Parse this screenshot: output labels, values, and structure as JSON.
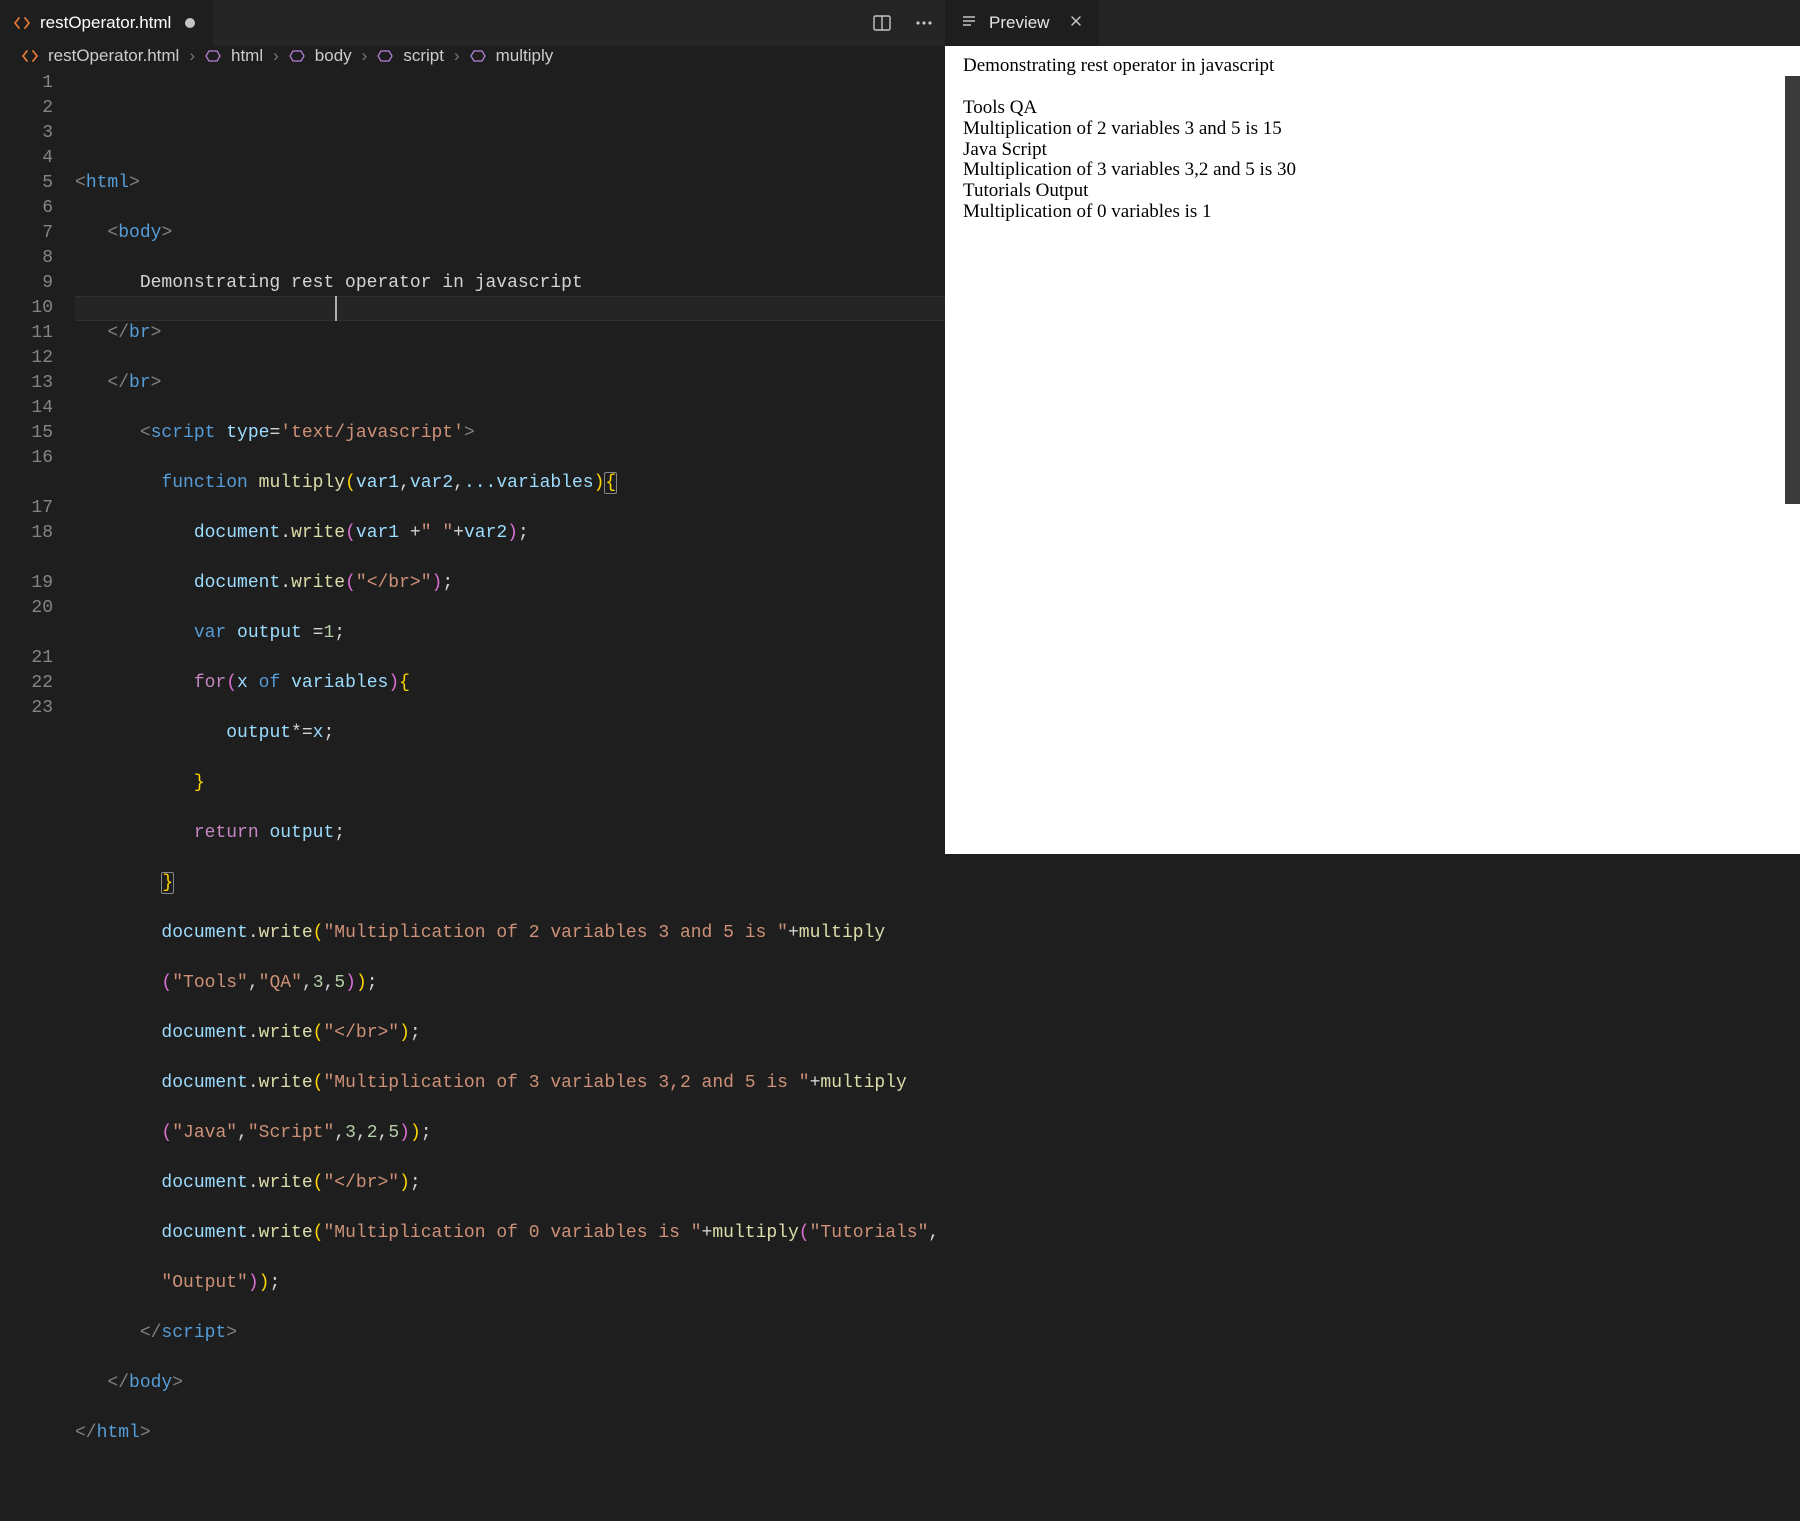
{
  "tab": {
    "filename": "restOperator.html",
    "dirty": true
  },
  "tabbar_icons": {
    "split": "split-editor-icon",
    "more": "more-icon"
  },
  "breadcrumb": {
    "file": "restOperator.html",
    "items": [
      "html",
      "body",
      "script",
      "multiply"
    ]
  },
  "gutter_lines": [
    "1",
    "2",
    "3",
    "4",
    "5",
    "6",
    "7",
    "8",
    "9",
    "10",
    "11",
    "12",
    "13",
    "14",
    "15",
    "16",
    "",
    "17",
    "18",
    "",
    "19",
    "20",
    "",
    "21",
    "22",
    "23"
  ],
  "code": {
    "l1_open": "<",
    "l1_tag": "html",
    "l1_close": ">",
    "l2_tag": "body",
    "l3_text": "Demonstrating rest operator in javascript",
    "l4_tag": "br",
    "l6_tag": "script",
    "l6_attr": "type",
    "l6_val": "'text/javascript'",
    "l7_kw": "function",
    "l7_fn": "multiply",
    "l7_args_v1": "var1",
    "l7_args_v2": "var2",
    "l7_args_rest": "...variables",
    "l8_obj": "document",
    "l8_fn": "write",
    "l8_a1": "var1",
    "l8_plus": " +\" \"+",
    "l8_a2": "var2",
    "l9_arg": "\"</br>\"",
    "l10_kw": "var",
    "l10_name": "output",
    "l10_eq": " =",
    "l10_val": "1",
    "l11_kw": "for",
    "l11_x": "x",
    "l11_of": "of",
    "l11_it": "variables",
    "l12_stmt": "output*=x;",
    "l14_kw": "return",
    "l14_v": "output",
    "l16_pre": "\"Multiplication of 2 variables 3 and 5 is \"",
    "l16_fn": "multiply",
    "l16b_args": "\"Tools\",\"QA\",3,5",
    "l18_pre": "\"Multiplication of 3 variables 3,2 and 5 is \"",
    "l18b_args": "\"Java\",\"Script\",3,2,5",
    "l20_pre": "\"Multiplication of 0 variables is \"",
    "l20_args": "\"Tutorials\",",
    "l20b_args": "\"Output\""
  },
  "preview": {
    "tab_label": "Preview",
    "lines": [
      "Demonstrating rest operator in javascript",
      "",
      "Tools QA",
      "Multiplication of 2 variables 3 and 5 is 15",
      "Java Script",
      "Multiplication of 3 variables 3,2 and 5 is 30",
      "Tutorials Output",
      "Multiplication of 0 variables is 1"
    ]
  }
}
